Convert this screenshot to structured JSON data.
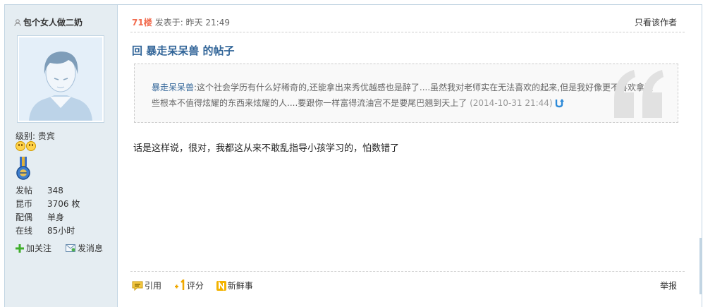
{
  "sidebar": {
    "username": "包个女人做二奶",
    "level_label": "级别: 贵宾",
    "stats": [
      {
        "key": "发帖",
        "value": "348"
      },
      {
        "key": "昆币",
        "value": "3706 枚"
      },
      {
        "key": "配偶",
        "value": "单身"
      },
      {
        "key": "在线",
        "value": "85小时"
      }
    ],
    "follow_label": "加关注",
    "message_label": "发消息"
  },
  "post": {
    "floor": "71楼",
    "posted_at": "发表于: 昨天 21:49",
    "author_only": "只看该作者",
    "title": "回 暴走呆呆兽 的帖子",
    "quote": {
      "author": "暴走呆呆兽",
      "text": ":这个社会学历有什么好稀奇的,还能拿出来秀优越感也是醉了....虽然我对老师实在无法喜欢的起来,但是我好像更不喜欢拿这些根本不值得炫耀的东西来炫耀的人....要跟你一样富得流油宫不是要尾巴翘到天上了",
      "date": "(2014-10-31 21:44)"
    },
    "body": "话是这样说，很对，我都这从来不敢乱指导小孩学习的，怕数错了"
  },
  "footer": {
    "quote_label": "引用",
    "rate_label": "评分",
    "fresh_label": "新鲜事",
    "report_label": "举报"
  },
  "colors": {
    "sidebar_bg": "#e5edf2",
    "border": "#c2d5e3",
    "link_blue": "#336699",
    "floor_orange": "#f26c4f"
  }
}
